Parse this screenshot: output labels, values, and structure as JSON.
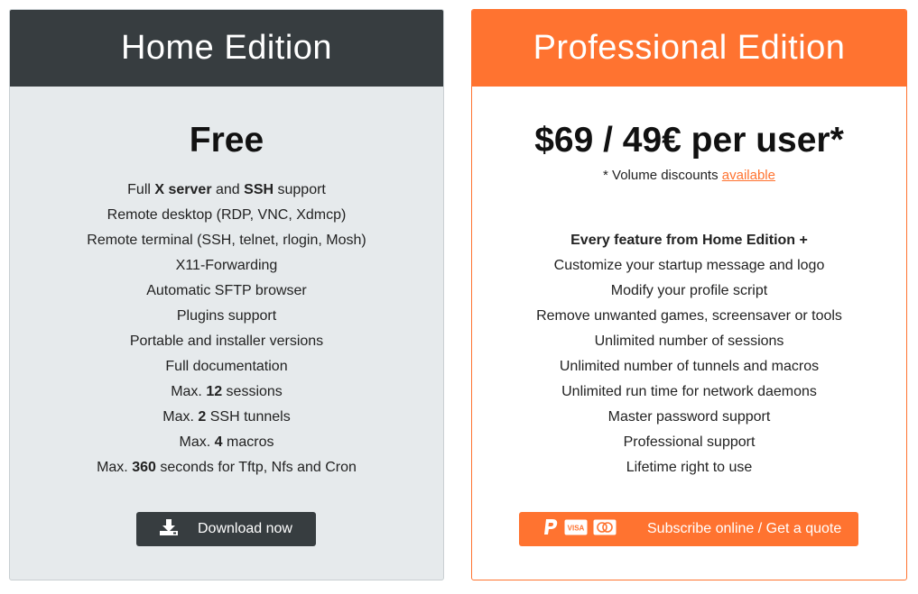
{
  "home": {
    "title": "Home Edition",
    "price": "Free",
    "features": [
      {
        "pre": "Full ",
        "b1": "X server",
        "mid": " and ",
        "b2": "SSH",
        "post": " support"
      },
      {
        "text": "Remote desktop (RDP, VNC, Xdmcp)"
      },
      {
        "text": "Remote terminal (SSH, telnet, rlogin, Mosh)"
      },
      {
        "text": "X11-Forwarding"
      },
      {
        "text": "Automatic SFTP browser"
      },
      {
        "text": "Plugins support"
      },
      {
        "text": "Portable and installer versions"
      },
      {
        "text": "Full documentation"
      },
      {
        "pre": "Max. ",
        "b1": "12",
        "post": " sessions"
      },
      {
        "pre": "Max. ",
        "b1": "2",
        "post": " SSH tunnels"
      },
      {
        "pre": "Max. ",
        "b1": "4",
        "post": " macros"
      },
      {
        "pre": "Max. ",
        "b1": "360",
        "post": " seconds for Tftp, Nfs and Cron"
      }
    ],
    "button": {
      "label": "Download now",
      "icon": "download-icon"
    }
  },
  "pro": {
    "title": "Professional Edition",
    "price": "$69 / 49€ per user*",
    "note_prefix": "* Volume discounts ",
    "note_link": "available",
    "features_header": "Every feature from Home Edition +",
    "features": [
      "Customize your startup message and logo",
      "Modify your profile script",
      "Remove unwanted games, screensaver or tools",
      "Unlimited number of sessions",
      "Unlimited number of tunnels and macros",
      "Unlimited run time for network daemons",
      "Master password support",
      "Professional support",
      "Lifetime right to use"
    ],
    "button": {
      "label": "Subscribe online / Get a quote",
      "icons": [
        "paypal-icon",
        "visa-icon",
        "mastercard-icon"
      ],
      "visa_text": "VISA"
    }
  },
  "colors": {
    "home_header": "#373d40",
    "pro_accent": "#ff7330",
    "home_bg": "#e6eaec"
  }
}
